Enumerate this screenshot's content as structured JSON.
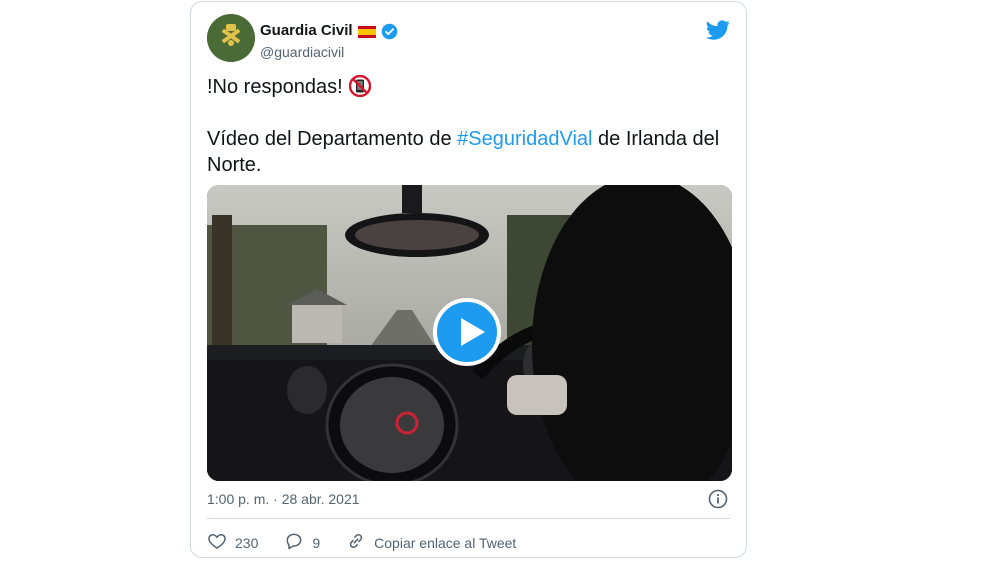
{
  "tweet": {
    "author_name": "Guardia Civil",
    "author_handle": "@guardiacivil",
    "line1": "!No respondas!",
    "line2_before": "Vídeo del Departamento de ",
    "hashtag": "#SeguridadVial",
    "line2_after": " de Irlanda del Norte.",
    "timestamp": "1:00 p. m. · 28 abr. 2021",
    "like_count": "230",
    "reply_count": "9",
    "copy_link_label": "Copiar enlace al Tweet"
  },
  "colors": {
    "accent": "#1d9bf0",
    "secondary_text": "#536471",
    "border": "#cfd9de"
  },
  "icons": [
    "flag-spain-icon",
    "verified-badge-icon",
    "twitter-bird-icon",
    "no-mobile-icon",
    "play-icon",
    "info-icon",
    "heart-icon",
    "reply-icon",
    "link-icon"
  ]
}
